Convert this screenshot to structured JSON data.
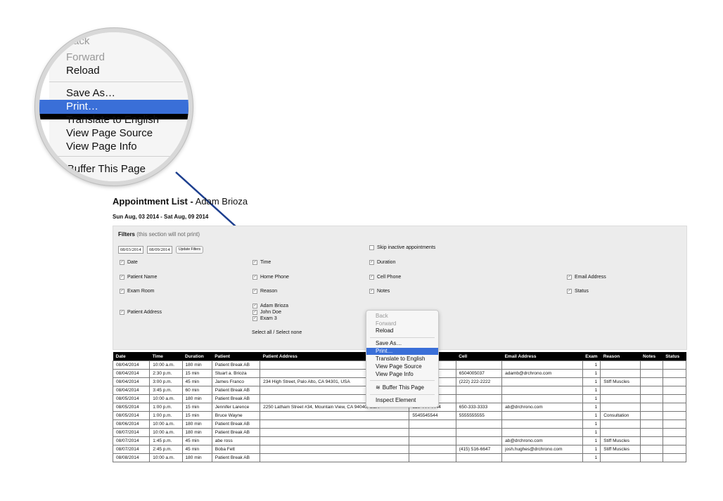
{
  "magnifier": {
    "items": [
      {
        "label": "Back",
        "disabled": true
      },
      {
        "label": "Forward",
        "disabled": true
      },
      {
        "label": "Reload",
        "disabled": false
      },
      {
        "label": "Save As…",
        "disabled": false
      },
      {
        "label": "Print…",
        "disabled": false,
        "selected": true
      },
      {
        "label": "Translate to English",
        "disabled": false
      },
      {
        "label": "View Page Source",
        "disabled": false
      },
      {
        "label": "View Page Info",
        "disabled": false
      },
      {
        "label": "Buffer This Page",
        "disabled": false
      }
    ]
  },
  "page": {
    "title_bold": "Appointment List -",
    "title_name": " Adam Brioza",
    "date_range": "Sun Aug, 03 2014 - Sat Aug, 09 2014"
  },
  "filters": {
    "heading": "Filters",
    "note": " (this section will not print)",
    "start_date": "08/03/2014",
    "end_date": "08/09/2014",
    "update_label": "Update Filters",
    "skip_label": "Skip inactive appointments",
    "checkboxes": {
      "date": "Date",
      "time": "Time",
      "duration": "Duration",
      "patient_name": "Patient Name",
      "home_phone": "Home Phone",
      "cell_phone": "Cell Phone",
      "email": "Email Address",
      "exam_room": "Exam Room",
      "reason": "Reason",
      "notes": "Notes",
      "status": "Status",
      "patient_address": "Patient Address",
      "doc1": "Adam Brioza",
      "doc2": "John Doe",
      "doc3": "Exam 3"
    },
    "select_all": "Select all / Select none"
  },
  "table": {
    "headers": [
      "Date",
      "Time",
      "Duration",
      "Patient",
      "Patient Address",
      "",
      "Cell",
      "Email Address",
      "Exam",
      "Reason",
      "Notes",
      "Status"
    ],
    "rows": [
      [
        "08/04/2014",
        "10:00 a.m.",
        "180 min",
        "Patient Break AB",
        "",
        "",
        "",
        "",
        "1",
        "",
        "",
        ""
      ],
      [
        "08/04/2014",
        "2:30 p.m.",
        "15 min",
        "Stuart a. Brioza",
        "",
        "",
        "6504005037",
        "adamb@drchrono.com",
        "1",
        "",
        "",
        ""
      ],
      [
        "08/04/2014",
        "3:00 p.m.",
        "45 min",
        "James Franco",
        "234 High Street, Palo Alto, CA 94301, USA",
        "222",
        "(222) 222-2222",
        "",
        "1",
        "Stiff Muscles",
        "",
        ""
      ],
      [
        "08/04/2014",
        "3:45 p.m.",
        "60 min",
        "Patient Break AB",
        "",
        "",
        "",
        "",
        "1",
        "",
        "",
        ""
      ],
      [
        "08/05/2014",
        "10:00 a.m.",
        "180 min",
        "Patient Break AB",
        "",
        "",
        "",
        "",
        "1",
        "",
        "",
        ""
      ],
      [
        "08/05/2014",
        "1:00 p.m.",
        "15 min",
        "Jennifer Larence",
        "2250 Latham Street #34, Mountain View, CA 94040, USA",
        "650-444-4444",
        "650-333-3333",
        "ab@drchrono.com",
        "1",
        "",
        "",
        ""
      ],
      [
        "08/05/2014",
        "1:00 p.m.",
        "15 min",
        "Bruce Wayne",
        "",
        "5545545544",
        "5555555555",
        "",
        "1",
        "Consultation",
        "",
        ""
      ],
      [
        "08/06/2014",
        "10:00 a.m.",
        "180 min",
        "Patient Break AB",
        "",
        "",
        "",
        "",
        "1",
        "",
        "",
        ""
      ],
      [
        "08/07/2014",
        "10:00 a.m.",
        "180 min",
        "Patient Break AB",
        "",
        "",
        "",
        "",
        "1",
        "",
        "",
        ""
      ],
      [
        "08/07/2014",
        "1:45 p.m.",
        "45 min",
        "abe ross",
        "",
        "",
        "",
        "ab@drchrono.com",
        "1",
        "Stiff Muscles",
        "",
        ""
      ],
      [
        "08/07/2014",
        "2:45 p.m.",
        "45 min",
        "Boba Fett",
        "",
        "",
        "(415) 516-6647",
        "josh.hughes@drchrono.com",
        "1",
        "Stiff Muscles",
        "",
        ""
      ],
      [
        "08/08/2014",
        "10:00 a.m.",
        "180 min",
        "Patient Break AB",
        "",
        "",
        "",
        "",
        "1",
        "",
        "",
        ""
      ]
    ]
  },
  "context_menu": {
    "back": "Back",
    "forward": "Forward",
    "reload": "Reload",
    "save_as": "Save As…",
    "print": "Print…",
    "translate": "Translate to English",
    "view_source": "View Page Source",
    "view_info": "View Page Info",
    "buffer": "Buffer This Page",
    "inspect": "Inspect Element"
  },
  "colors": {
    "selection": "#3a6fd8",
    "arrow": "#1d3f8f"
  }
}
